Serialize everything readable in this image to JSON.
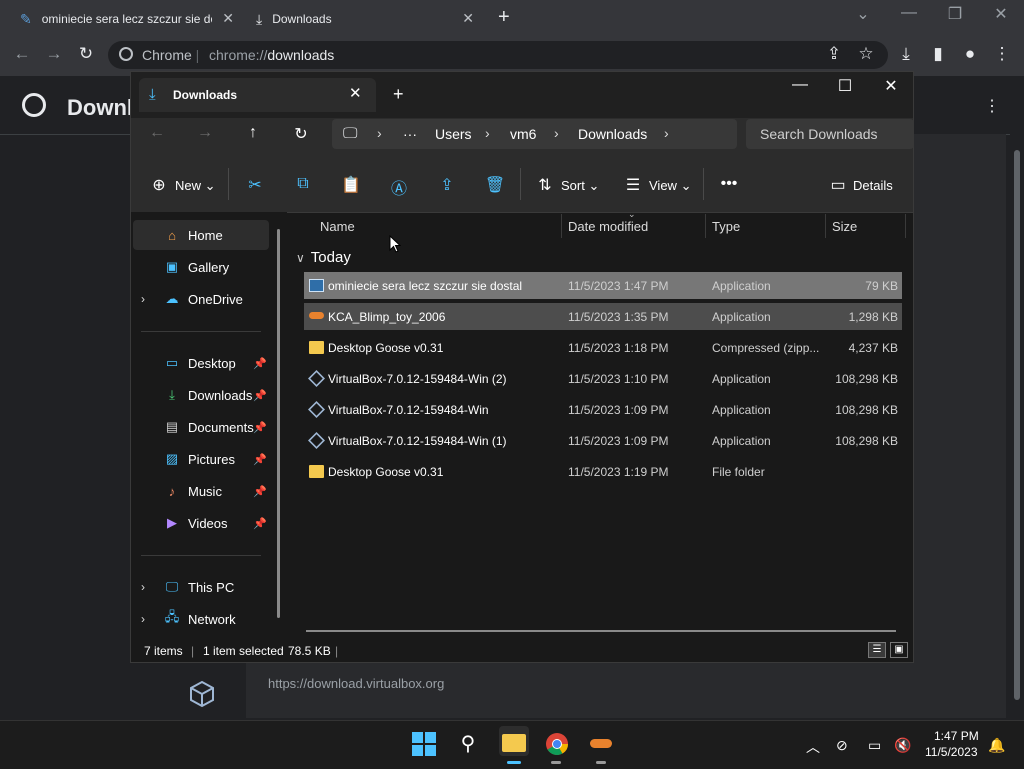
{
  "chrome": {
    "tabs": [
      {
        "title": "ominiecie sera lecz szczur sie dostal",
        "icon": "blimp-icon"
      },
      {
        "title": "Downloads",
        "icon": "download-icon"
      }
    ],
    "site_label": "Chrome",
    "url_scheme": "chrome://",
    "url_path": "downloads",
    "page_title": "Downloads",
    "download_link": "https://download.virtualbox.org"
  },
  "explorer": {
    "tab_title": "Downloads",
    "breadcrumb": [
      "Users",
      "vm6",
      "Downloads"
    ],
    "search_placeholder": "Search Downloads",
    "commands": {
      "new": "New",
      "sort": "Sort",
      "view": "View",
      "details": "Details"
    },
    "nav": {
      "home": "Home",
      "gallery": "Gallery",
      "onedrive": "OneDrive",
      "desktop": "Desktop",
      "downloads": "Downloads",
      "documents": "Documents",
      "pictures": "Pictures",
      "music": "Music",
      "videos": "Videos",
      "thispc": "This PC",
      "network": "Network"
    },
    "columns": {
      "name": "Name",
      "date": "Date modified",
      "type": "Type",
      "size": "Size"
    },
    "group": "Today",
    "files": [
      {
        "name": "ominiecie sera lecz szczur sie dostal",
        "date": "11/5/2023 1:47 PM",
        "type": "Application",
        "size": "79 KB",
        "icon": "app-window-icon"
      },
      {
        "name": "KCA_Blimp_toy_2006",
        "date": "11/5/2023 1:35 PM",
        "type": "Application",
        "size": "1,298 KB",
        "icon": "blimp-icon"
      },
      {
        "name": "Desktop Goose v0.31",
        "date": "11/5/2023 1:18 PM",
        "type": "Compressed (zipp...",
        "size": "4,237 KB",
        "icon": "zip-folder-icon"
      },
      {
        "name": "VirtualBox-7.0.12-159484-Win (2)",
        "date": "11/5/2023 1:10 PM",
        "type": "Application",
        "size": "108,298 KB",
        "icon": "virtualbox-icon"
      },
      {
        "name": "VirtualBox-7.0.12-159484-Win",
        "date": "11/5/2023 1:09 PM",
        "type": "Application",
        "size": "108,298 KB",
        "icon": "virtualbox-icon"
      },
      {
        "name": "VirtualBox-7.0.12-159484-Win (1)",
        "date": "11/5/2023 1:09 PM",
        "type": "Application",
        "size": "108,298 KB",
        "icon": "virtualbox-icon"
      },
      {
        "name": "Desktop Goose v0.31",
        "date": "11/5/2023 1:19 PM",
        "type": "File folder",
        "size": "",
        "icon": "folder-icon"
      }
    ],
    "status": {
      "count": "7 items",
      "selected": "1 item selected",
      "size": "78.5 KB"
    }
  },
  "taskbar": {
    "time": "1:47 PM",
    "date": "11/5/2023"
  },
  "colors": {
    "selection_primary": "#777777",
    "selection_secondary": "#4d4d4d",
    "folder": "#f4c94e",
    "accent_blue": "#4cc2ff"
  }
}
